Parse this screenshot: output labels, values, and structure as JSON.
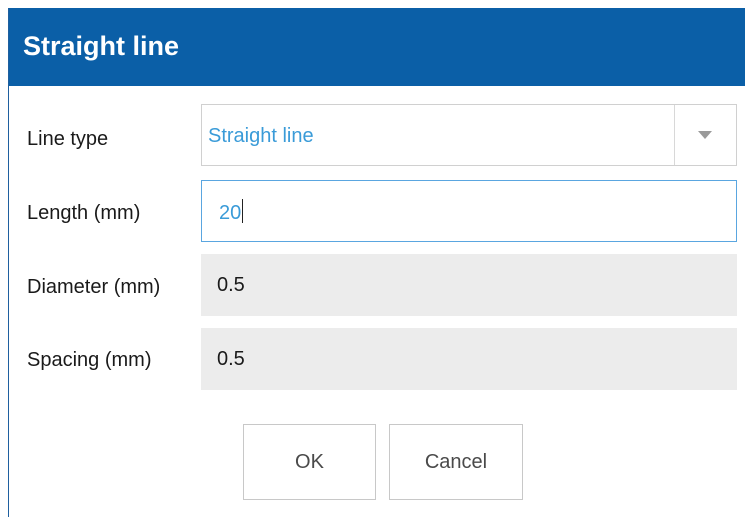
{
  "dialog": {
    "title": "Straight line"
  },
  "form": {
    "line_type": {
      "label": "Line type",
      "value": "Straight line"
    },
    "length": {
      "label": "Length (mm)",
      "value": "20"
    },
    "diameter": {
      "label": "Diameter (mm)",
      "value": "0.5"
    },
    "spacing": {
      "label": "Spacing (mm)",
      "value": "0.5"
    }
  },
  "buttons": {
    "ok": "OK",
    "cancel": "Cancel"
  },
  "icons": {
    "dropdown": "chevron-down-icon"
  },
  "colors": {
    "title_bar": "#0b5fa7",
    "value_text": "#3a9bd8",
    "readonly_background": "#ececec",
    "focus_border": "#5aa6e0"
  }
}
